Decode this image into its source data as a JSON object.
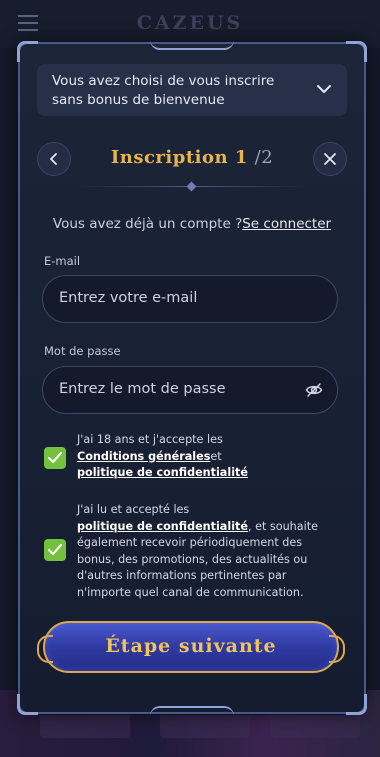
{
  "background": {
    "logo": "CAZEUS"
  },
  "bonus_notice": {
    "text": "Vous avez choisi de vous inscrire sans bonus de bienvenue",
    "chevron_icon": "chevron-down-icon"
  },
  "header": {
    "title": "Inscription 1",
    "step": "/2",
    "back_icon": "chevron-left-icon",
    "close_icon": "close-icon"
  },
  "login": {
    "prompt": "Vous avez déjà un compte ?",
    "link": "Se connecter"
  },
  "email": {
    "label": "E-mail",
    "placeholder": "Entrez votre e-mail"
  },
  "password": {
    "label": "Mot de passe",
    "placeholder": "Entrez le mot de passe",
    "toggle_icon": "eye-slash-icon"
  },
  "consents": [
    {
      "checked": true,
      "text_before": "J'ai 18 ans et j'accepte les ",
      "link1": "Conditions générales",
      "text_mid": "et ",
      "link2": "politique de confidentialité",
      "text_after": ""
    },
    {
      "checked": true,
      "text_before": "J'ai lu et accepté les ",
      "link1": "politique de confidentialité",
      "text_after": ", et souhaite également recevoir périodiquement des bonus, des promotions, des actualités ou d'autres informations pertinentes par n'importe quel canal de communication."
    }
  ],
  "cta": {
    "label": "Étape suivante"
  },
  "colors": {
    "accent_gold": "#e8b54a",
    "checkbox_green": "#73c23e",
    "button_blue": "#2f3aa3"
  }
}
